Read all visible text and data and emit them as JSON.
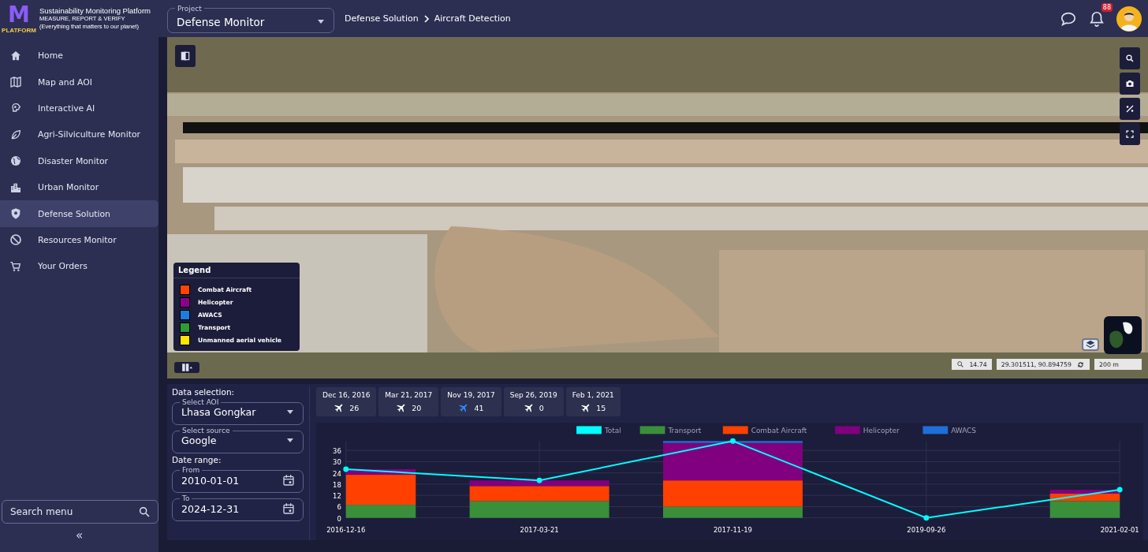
{
  "header": {
    "logo_letter": "M",
    "logo_text": "PLATFORM",
    "title": "Sustainability Monitoring Platform",
    "subtitle": "MEASURE, REPORT & VERIFY",
    "tagline": "(Everything that matters to our planet)",
    "project": {
      "label": "Project",
      "value": "Defense Monitor"
    },
    "breadcrumb": [
      "Defense Solution",
      "Aircraft Detection"
    ],
    "notification_count": "88"
  },
  "sidebar": {
    "items": [
      {
        "label": "Home",
        "selected": false
      },
      {
        "label": "Map and AOI",
        "selected": false
      },
      {
        "label": "Interactive AI",
        "selected": false
      },
      {
        "label": "Agri-Silviculture Monitor",
        "selected": false
      },
      {
        "label": "Disaster Monitor",
        "selected": false
      },
      {
        "label": "Urban Monitor",
        "selected": false
      },
      {
        "label": "Defense Solution",
        "selected": true
      },
      {
        "label": "Resources Monitor",
        "selected": false
      },
      {
        "label": "Your Orders",
        "selected": false
      }
    ],
    "search": {
      "placeholder": "Search menu"
    },
    "collapse": "«"
  },
  "map": {
    "legend": {
      "title": "Legend",
      "items": [
        {
          "label": "Combat Aircraft",
          "color": "#ff4500"
        },
        {
          "label": "Helicopter",
          "color": "#8b008b"
        },
        {
          "label": "AWACS",
          "color": "#1e7be0"
        },
        {
          "label": "Transport",
          "color": "#2e9a38"
        },
        {
          "label": "Unmanned aerial vehicle",
          "color": "#ffe600"
        }
      ]
    },
    "zoom": "14.74",
    "coordinates": "29.301511, 90.894759",
    "scale": "200 m"
  },
  "data_selection": {
    "title": "Data selection:",
    "aoi": {
      "label": "Select AOI",
      "value": "Lhasa Gongkar"
    },
    "source": {
      "label": "Select source",
      "value": "Google"
    },
    "date_range": "Date range:",
    "from": {
      "label": "From",
      "value": "2010-01-01"
    },
    "to": {
      "label": "To",
      "value": "2024-12-31"
    }
  },
  "dates": [
    {
      "date": "Dec 16, 2016",
      "count": "26",
      "selected": false
    },
    {
      "date": "Mar 21, 2017",
      "count": "20",
      "selected": false
    },
    {
      "date": "Nov 19, 2017",
      "count": "41",
      "selected": true
    },
    {
      "date": "Sep 26, 2019",
      "count": "0",
      "selected": false
    },
    {
      "date": "Feb 1, 2021",
      "count": "15",
      "selected": false
    }
  ],
  "chart": {
    "chart_data": {
      "type": "bar",
      "stacked": true,
      "categories": [
        "2016-12-16",
        "2017-03-21",
        "2017-11-19",
        "2019-09-26",
        "2021-02-01"
      ],
      "series": [
        {
          "name": "Total",
          "color": "#00ffff",
          "type": "line",
          "marker": true,
          "values": [
            26,
            20,
            41,
            0,
            15
          ]
        },
        {
          "name": "Transport",
          "color": "#3a8f3a",
          "values": [
            7,
            9,
            6,
            0,
            9
          ]
        },
        {
          "name": "Combat Aircraft",
          "color": "#ff4000",
          "values": [
            16,
            8,
            14,
            0,
            4
          ]
        },
        {
          "name": "Helicopter",
          "color": "#800080",
          "values": [
            3,
            3,
            20,
            0,
            2
          ]
        },
        {
          "name": "AWACS",
          "color": "#1e6fd9",
          "values": [
            0,
            0,
            1,
            0,
            0
          ]
        }
      ],
      "grid": true,
      "legend": true,
      "ylim": [
        0,
        41
      ],
      "yticks": [
        0,
        6,
        12,
        18,
        24,
        30,
        36
      ]
    }
  }
}
